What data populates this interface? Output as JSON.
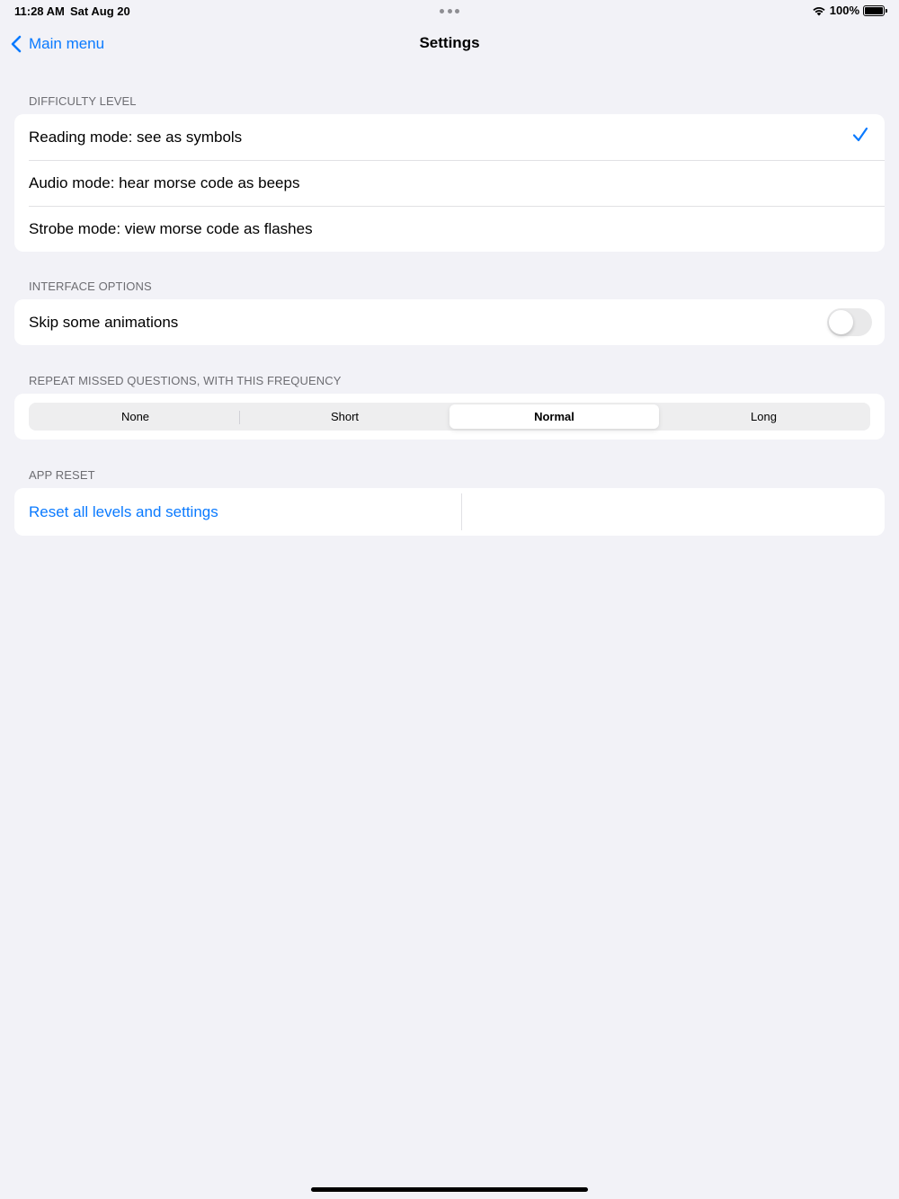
{
  "status_bar": {
    "time": "11:28 AM",
    "date": "Sat Aug 20",
    "battery": "100%",
    "icons": [
      "wifi-icon",
      "battery-icon"
    ]
  },
  "nav": {
    "back_label": "Main menu",
    "title": "Settings"
  },
  "sections": {
    "difficulty": {
      "header": "DIFFICULTY LEVEL",
      "options": [
        "Reading mode: see as symbols",
        "Audio mode: hear morse code as beeps",
        "Strobe mode: view morse code as flashes"
      ],
      "selected_index": 0
    },
    "interface": {
      "header": "INTERFACE OPTIONS",
      "skip_animations_label": "Skip some animations",
      "skip_animations_on": false
    },
    "repeat": {
      "header": "REPEAT MISSED QUESTIONS, WITH THIS FREQUENCY",
      "segments": [
        "None",
        "Short",
        "Normal",
        "Long"
      ],
      "selected": "Normal"
    },
    "reset": {
      "header": "APP RESET",
      "button_label": "Reset all levels and settings"
    }
  },
  "colors": {
    "accent": "#0a7aff",
    "background": "#f2f2f7",
    "secondary_text": "#6d6d72"
  }
}
